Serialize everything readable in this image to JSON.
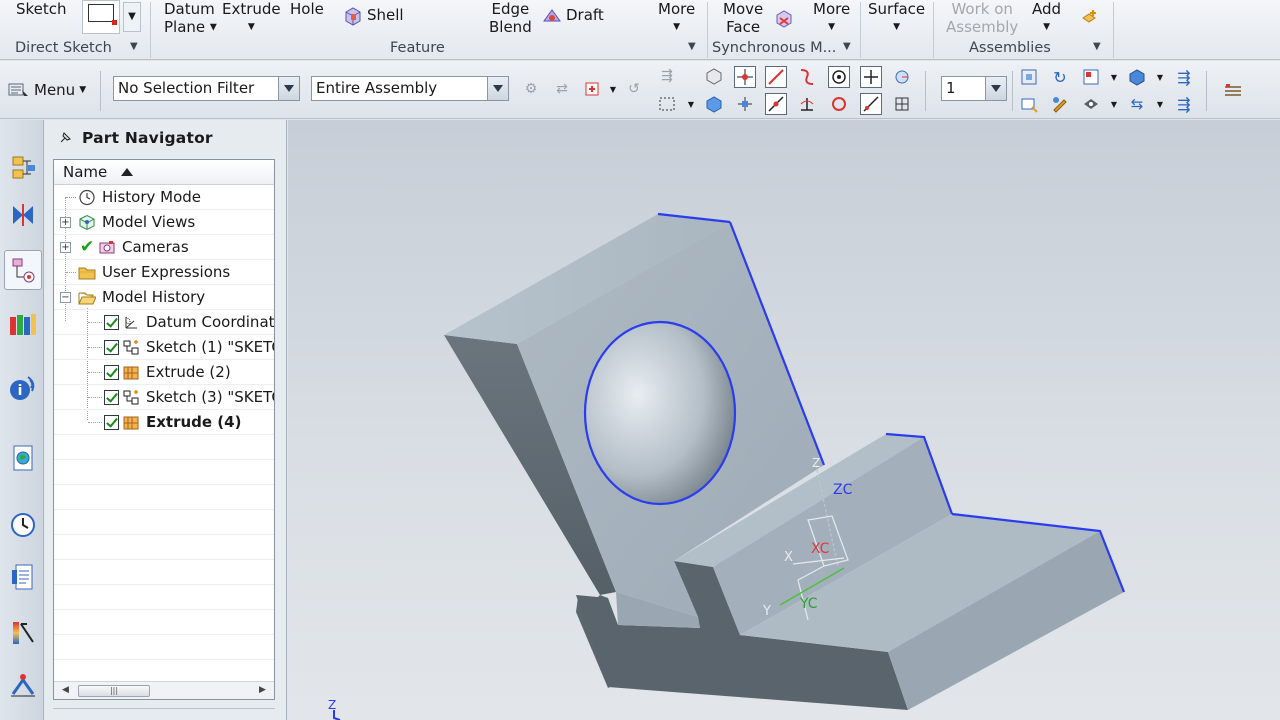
{
  "ribbon": {
    "sketch": "Sketch",
    "datum_line1": "Datum",
    "datum_line2": "Plane",
    "extrude": "Extrude",
    "hole": "Hole",
    "shell": "Shell",
    "edge_line1": "Edge",
    "edge_line2": "Blend",
    "draft": "Draft",
    "more_feature": "More",
    "move_line1": "Move",
    "move_line2": "Face",
    "more_sync": "More",
    "surface": "Surface",
    "work_line1": "Work on",
    "work_line2": "Assembly",
    "add": "Add",
    "groups": {
      "direct_sketch": "Direct Sketch",
      "feature": "Feature",
      "synchronous": "Synchronous M...",
      "assemblies": "Assemblies"
    }
  },
  "toolbar": {
    "menu_label": "Menu",
    "selection_filter": "No Selection Filter",
    "scope": "Entire Assembly",
    "layer": "1"
  },
  "navigator": {
    "title": "Part Navigator",
    "column": "Name",
    "items": [
      {
        "label": "History Mode"
      },
      {
        "label": "Model Views"
      },
      {
        "label": "Cameras"
      },
      {
        "label": "User Expressions"
      },
      {
        "label": "Model History"
      },
      {
        "label": "Datum Coordinat"
      },
      {
        "label": "Sketch (1) \"SKETC"
      },
      {
        "label": "Extrude (2)"
      },
      {
        "label": "Sketch (3) \"SKETC"
      },
      {
        "label": "Extrude (4)"
      }
    ]
  },
  "viewport": {
    "csys": {
      "zc": "ZC",
      "xc": "XC",
      "yc": "YC",
      "x": "X",
      "y": "Y",
      "z": "Z"
    },
    "triad": {
      "z": "Z"
    }
  },
  "colors": {
    "part_face_light": "#a9b6c0",
    "part_face_dark": "#5f6a72",
    "edge_highlight": "#2a3cf0"
  }
}
